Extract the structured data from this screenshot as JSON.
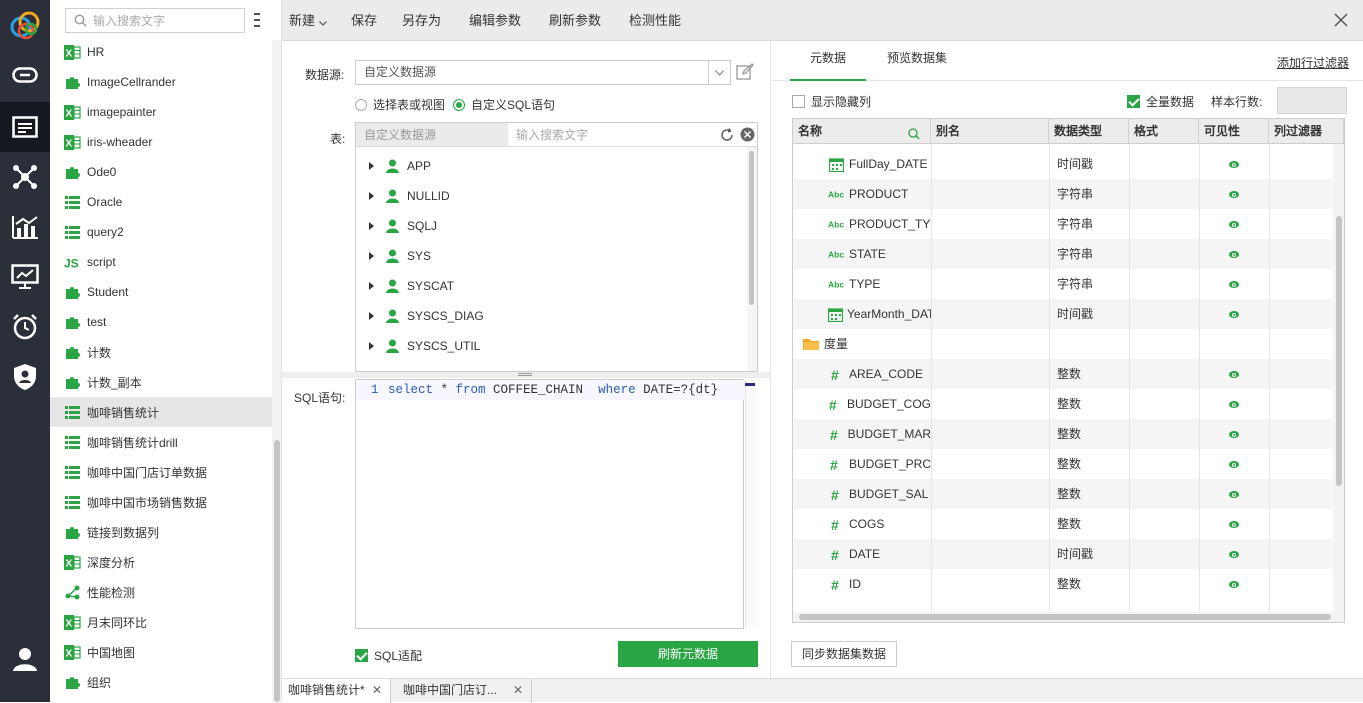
{
  "colors": {
    "accent": "#2aa543",
    "rail_bg": "#2b2f3a"
  },
  "rail": {
    "icons": [
      "logo-icon",
      "link-icon",
      "report-icon",
      "network-icon",
      "chart-icon",
      "dashboard-icon",
      "alarm-clock-icon",
      "shield-icon",
      "user-icon"
    ]
  },
  "tree": {
    "search_placeholder": "输入搜索文字",
    "items": [
      {
        "label": "HR",
        "icon": "excel-icon"
      },
      {
        "label": "ImageCellrander",
        "icon": "plugin-icon"
      },
      {
        "label": "imagepainter",
        "icon": "excel-icon"
      },
      {
        "label": "iris-wheader",
        "icon": "excel-icon"
      },
      {
        "label": "Ode0",
        "icon": "plugin-icon"
      },
      {
        "label": "Oracle",
        "icon": "table-icon"
      },
      {
        "label": "query2",
        "icon": "table-icon"
      },
      {
        "label": "script",
        "icon": "js-icon"
      },
      {
        "label": "Student",
        "icon": "plugin-icon"
      },
      {
        "label": "test",
        "icon": "plugin-icon"
      },
      {
        "label": "计数",
        "icon": "plugin-icon"
      },
      {
        "label": "计数_副本",
        "icon": "plugin-icon"
      },
      {
        "label": "咖啡销售统计",
        "icon": "table-icon"
      },
      {
        "label": "咖啡销售统计drill",
        "icon": "table-icon"
      },
      {
        "label": "咖啡中国门店订单数据",
        "icon": "table-icon"
      },
      {
        "label": "咖啡中国市场销售数据",
        "icon": "table-icon"
      },
      {
        "label": "链接到数据列",
        "icon": "plugin-icon"
      },
      {
        "label": "深度分析",
        "icon": "excel-icon"
      },
      {
        "label": "性能检测",
        "icon": "flow-icon"
      },
      {
        "label": "月末同环比",
        "icon": "excel-icon"
      },
      {
        "label": "中国地图",
        "icon": "excel-icon"
      },
      {
        "label": "组织",
        "icon": "plugin-icon"
      }
    ]
  },
  "toolbar": {
    "new_label": "新建",
    "save_label": "保存",
    "save_as_label": "另存为",
    "edit_params_label": "编辑参数",
    "refresh_params_label": "刷新参数",
    "check_perf_label": "检测性能"
  },
  "center": {
    "datasource_label": "数据源:",
    "datasource_value": "自定义数据源",
    "radio_table": "选择表或视图",
    "radio_sql": "自定义SQL语句",
    "table_label": "表:",
    "table_source": "自定义数据源",
    "table_search_placeholder": "输入搜索文字",
    "schemas": [
      "APP",
      "NULLID",
      "SQLJ",
      "SYS",
      "SYSCAT",
      "SYSCS_DIAG",
      "SYSCS_UTIL"
    ],
    "sql_label": "SQL语句:",
    "sql_line_no": "1",
    "sql": {
      "kw1": "select",
      "star": " * ",
      "kw2": "from",
      "table": " COFFEE_CHAIN  ",
      "kw3": "where",
      "cond": " DATE=?{dt}"
    },
    "sql_adapt_label": "SQL适配",
    "refresh_meta_label": "刷新元数据"
  },
  "right": {
    "tab_meta": "元数据",
    "tab_preview": "预览数据集",
    "add_filter_label": "添加行过滤器",
    "show_hidden_label": "显示隐藏列",
    "full_data_label": "全量数据",
    "sample_rows_label": "样本行数:",
    "columns": [
      "名称",
      "别名",
      "数据类型",
      "格式",
      "可见性",
      "列过滤器"
    ],
    "rows": [
      {
        "name": "FullDay_DATE",
        "type": "时间戳",
        "icon": "calendar-icon"
      },
      {
        "name": "PRODUCT",
        "type": "字符串",
        "icon": "abc-icon"
      },
      {
        "name": "PRODUCT_TY",
        "type": "字符串",
        "icon": "abc-icon"
      },
      {
        "name": "STATE",
        "type": "字符串",
        "icon": "abc-icon"
      },
      {
        "name": "TYPE",
        "type": "字符串",
        "icon": "abc-icon"
      },
      {
        "name": "YearMonth_DAT",
        "type": "时间戳",
        "icon": "calendar-icon"
      },
      {
        "name": "度量",
        "type": "",
        "icon": "folder-icon",
        "group": true
      },
      {
        "name": "AREA_CODE",
        "type": "整数",
        "icon": "hash-icon"
      },
      {
        "name": "BUDGET_COG",
        "type": "整数",
        "icon": "hash-icon"
      },
      {
        "name": "BUDGET_MAR",
        "type": "整数",
        "icon": "hash-icon"
      },
      {
        "name": "BUDGET_PRC",
        "type": "整数",
        "icon": "hash-icon"
      },
      {
        "name": "BUDGET_SAL",
        "type": "整数",
        "icon": "hash-icon"
      },
      {
        "name": "COGS",
        "type": "整数",
        "icon": "hash-icon"
      },
      {
        "name": "DATE",
        "type": "时间戳",
        "icon": "hash-icon"
      },
      {
        "name": "ID",
        "type": "整数",
        "icon": "hash-icon"
      }
    ],
    "sync_label": "同步数据集数据"
  },
  "bottom_tabs": [
    {
      "label": "咖啡销售统计*"
    },
    {
      "label": "咖啡中国门店订..."
    }
  ]
}
